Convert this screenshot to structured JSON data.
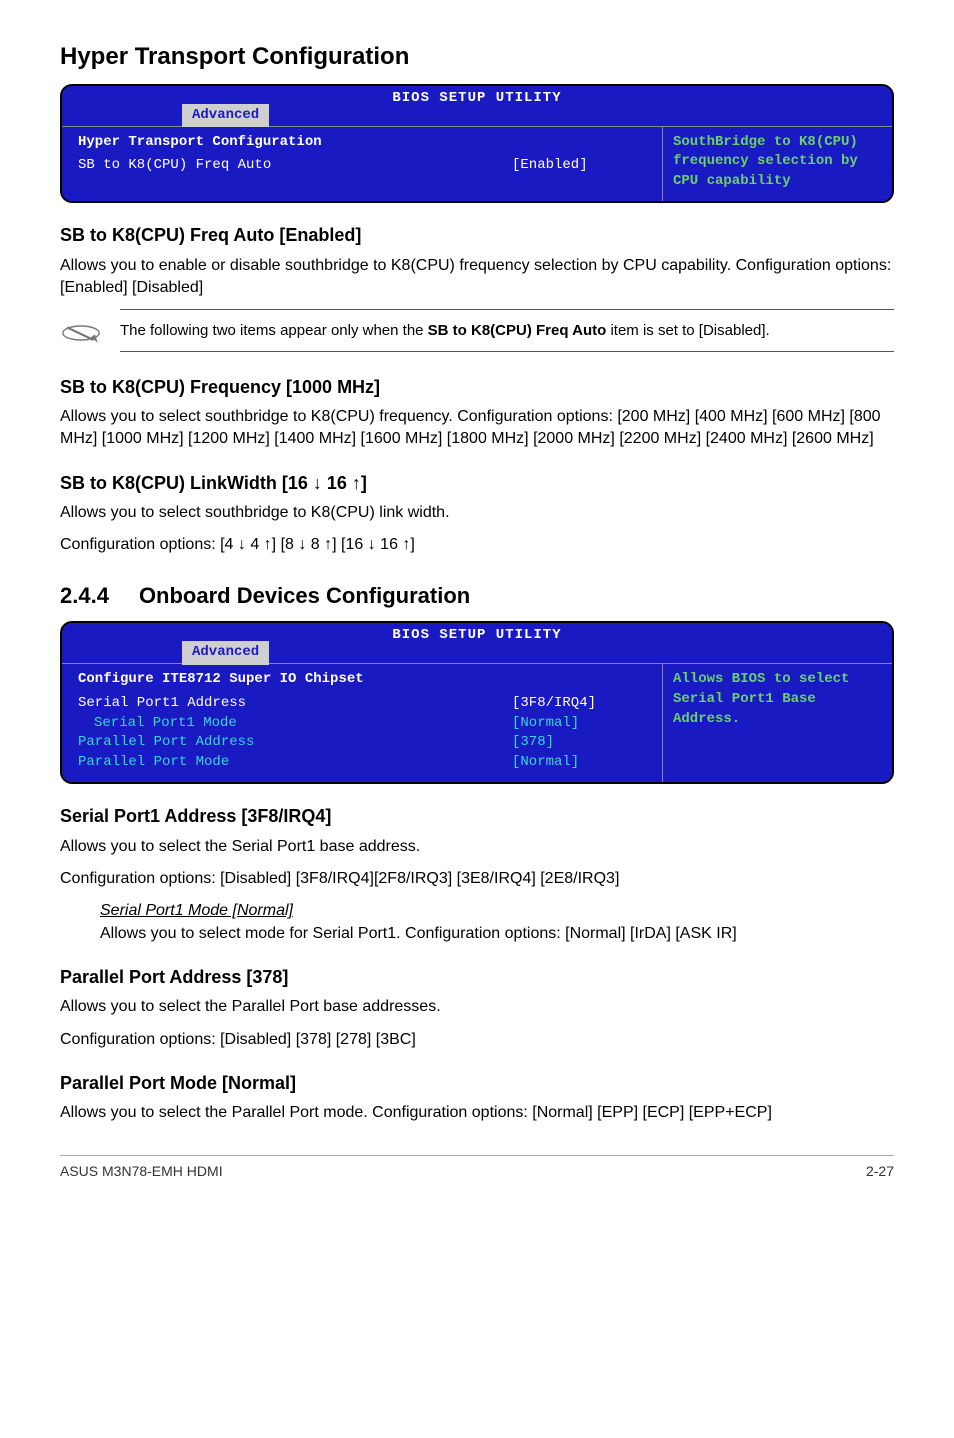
{
  "headings": {
    "hyperTransport": "Hyper Transport Configuration",
    "sbFreqAuto": "SB to K8(CPU) Freq Auto [Enabled]",
    "sbFrequency": "SB to K8(CPU) Frequency [1000 MHz]",
    "sbLinkWidth": "SB to K8(CPU) LinkWidth [16 ↓ 16 ↑]",
    "onboardDevices": "Onboard Devices Configuration",
    "onboardDevicesNum": "2.4.4",
    "serialPort1": "Serial Port1 Address [3F8/IRQ4]",
    "serialPort1ModeTitle": "Serial Port1 Mode [Normal]",
    "parallelPortAddr": "Parallel Port Address [378]",
    "parallelPortMode": "Parallel Port Mode [Normal]"
  },
  "paragraphs": {
    "sbFreqAuto": "Allows you to enable or disable southbridge to K8(CPU) frequency selection by CPU capability. Configuration options: [Enabled] [Disabled]",
    "note": "The following two items appear only when the SB to K8(CPU) Freq Auto item is set to [Disabled].",
    "noteBoldPart": "SB to K8(CPU) Freq Auto",
    "notePrefix": "The following two items appear only when the ",
    "noteSuffix": " item is set to [Disabled].",
    "sbFrequency": "Allows you to select  southbridge to K8(CPU) frequency. Configuration options: [200 MHz] [400 MHz] [600 MHz] [800 MHz] [1000 MHz] [1200 MHz] [1400 MHz] [1600 MHz] [1800 MHz] [2000 MHz] [2200 MHz] [2400 MHz] [2600 MHz]",
    "sbLinkWidth1": "Allows you to select southbridge to K8(CPU) link width.",
    "sbLinkWidth2": "Configuration options: [4 ↓ 4 ↑] [8 ↓ 8 ↑] [16 ↓ 16 ↑]",
    "serialPort1a": "Allows you to select the Serial Port1 base address.",
    "serialPort1b": "Configuration options: [Disabled] [3F8/IRQ4][2F8/IRQ3] [3E8/IRQ4] [2E8/IRQ3]",
    "serialPort1Mode": "Allows you to select mode for Serial Port1. Configuration options: [Normal] [IrDA] [ASK IR]",
    "parallelPortAddr1": "Allows you to select the Parallel Port base addresses.",
    "parallelPortAddr2": "Configuration options: [Disabled] [378] [278] [3BC]",
    "parallelPortMode": "Allows you to select the Parallel Port  mode. Configuration options: [Normal] [EPP] [ECP] [EPP+ECP]"
  },
  "bios1": {
    "title": "BIOS SETUP UTILITY",
    "tab": "Advanced",
    "sectionTitle": "Hyper Transport Configuration",
    "rows": [
      {
        "label": "SB to K8(CPU) Freq Auto",
        "value": "[Enabled]",
        "selected": true
      }
    ],
    "help": "SouthBridge to K8(CPU) frequency selection by CPU capability"
  },
  "bios2": {
    "title": "BIOS SETUP UTILITY",
    "tab": "Advanced",
    "sectionTitle": "Configure ITE8712 Super IO Chipset",
    "rows": [
      {
        "label": "Serial Port1 Address",
        "value": "[3F8/IRQ4]",
        "selected": true,
        "indent": false
      },
      {
        "label": "Serial Port1 Mode",
        "value": "[Normal]",
        "selected": false,
        "indent": true
      },
      {
        "label": "Parallel Port Address",
        "value": "[378]",
        "selected": false,
        "indent": false
      },
      {
        "label": "Parallel Port Mode",
        "value": "[Normal]",
        "selected": false,
        "indent": false
      }
    ],
    "help": "Allows BIOS to select Serial Port1 Base Address."
  },
  "footer": {
    "left": "ASUS M3N78-EMH HDMI",
    "right": "2-27"
  }
}
